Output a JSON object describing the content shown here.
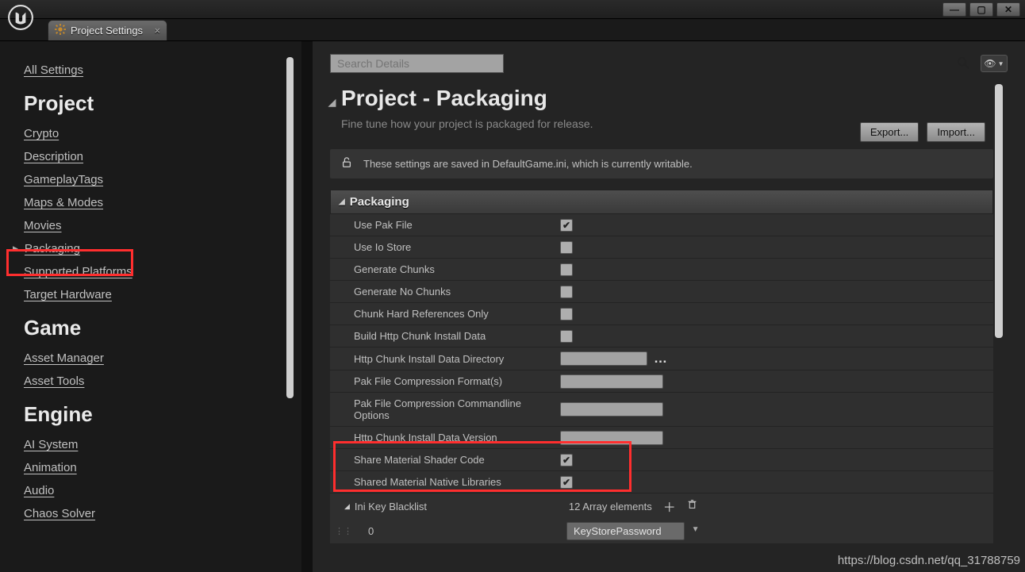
{
  "window": {
    "tab_title": "Project Settings"
  },
  "sidebar": {
    "all_settings": "All Settings",
    "groups": [
      {
        "title": "Project",
        "items": [
          "Crypto",
          "Description",
          "GameplayTags",
          "Maps & Modes",
          "Movies",
          "Packaging",
          "Supported Platforms",
          "Target Hardware"
        ]
      },
      {
        "title": "Game",
        "items": [
          "Asset Manager",
          "Asset Tools"
        ]
      },
      {
        "title": "Engine",
        "items": [
          "AI System",
          "Animation",
          "Audio",
          "Chaos Solver"
        ]
      }
    ]
  },
  "search": {
    "placeholder": "Search Details"
  },
  "header": {
    "title": "Project - Packaging",
    "subtitle": "Fine tune how your project is packaged for release.",
    "export_btn": "Export...",
    "import_btn": "Import...",
    "info": "These settings are saved in DefaultGame.ini, which is currently writable."
  },
  "section": {
    "title": "Packaging",
    "rows": [
      {
        "label": "Use Pak File",
        "type": "check",
        "checked": true
      },
      {
        "label": "Use Io Store",
        "type": "check",
        "checked": false
      },
      {
        "label": "Generate Chunks",
        "type": "check",
        "checked": false
      },
      {
        "label": "Generate No Chunks",
        "type": "check",
        "checked": false
      },
      {
        "label": "Chunk Hard References Only",
        "type": "check",
        "checked": false
      },
      {
        "label": "Build Http Chunk Install Data",
        "type": "check",
        "checked": false
      },
      {
        "label": "Http Chunk Install Data Directory",
        "type": "path"
      },
      {
        "label": "Pak File Compression Format(s)",
        "type": "text"
      },
      {
        "label": "Pak File Compression Commandline Options",
        "type": "text"
      },
      {
        "label": "Http Chunk Install Data Version",
        "type": "text"
      },
      {
        "label": "Share Material Shader Code",
        "type": "check",
        "checked": true
      },
      {
        "label": "Shared Material Native Libraries",
        "type": "check",
        "checked": true
      }
    ],
    "array": {
      "label": "Ini Key Blacklist",
      "count_text": "12 Array elements",
      "item_index": "0",
      "item_value": "KeyStorePassword"
    }
  },
  "watermark": "https://blog.csdn.net/qq_31788759"
}
